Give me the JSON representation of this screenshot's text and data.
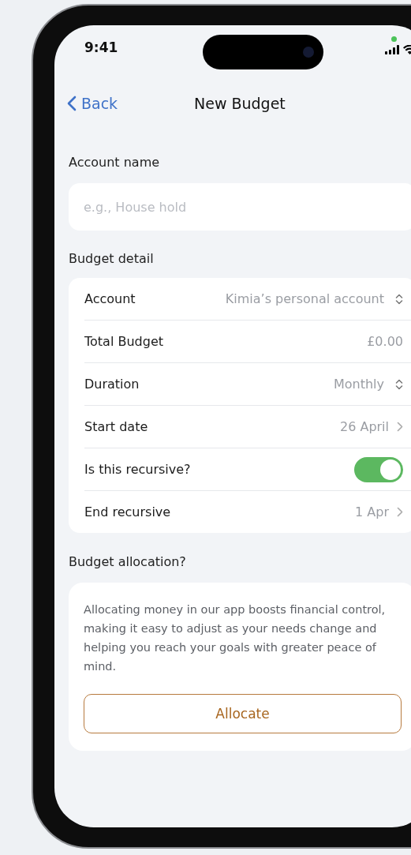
{
  "status_bar": {
    "time": "9:41"
  },
  "nav": {
    "back": "Back",
    "title": "New Budget"
  },
  "account_name": {
    "label": "Account name",
    "placeholder": "e.g., House hold"
  },
  "budget_detail": {
    "label": "Budget detail",
    "rows": [
      {
        "kind": "select",
        "label": "Account",
        "value": "Kimia’s personal account"
      },
      {
        "kind": "text",
        "label": "Total Budget",
        "value": "£0.00"
      },
      {
        "kind": "select",
        "label": "Duration",
        "value": "Monthly"
      },
      {
        "kind": "link",
        "label": "Start date",
        "value": "26 April"
      },
      {
        "kind": "toggle",
        "label": "Is this recursive?",
        "on": true
      },
      {
        "kind": "link",
        "label": "End recursive",
        "value": "1 Apr"
      }
    ]
  },
  "allocation": {
    "label": "Budget allocation?",
    "description": "Allocating money in our app boosts financial control, making it easy to adjust as your needs change and helping you reach your goals with greater peace of mind.",
    "button": "Allocate"
  }
}
